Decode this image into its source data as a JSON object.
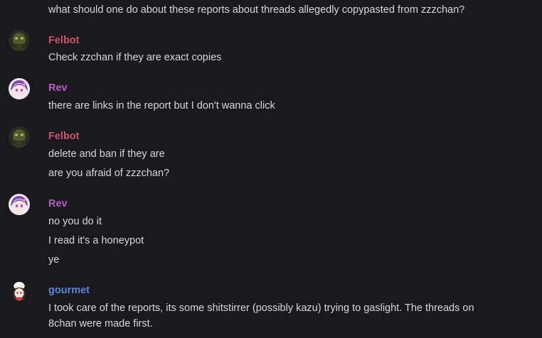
{
  "colors": {
    "background": "#1a1a1e",
    "text": "#d8d8da",
    "felbot": "#d0506e",
    "rev": "#b75bc6",
    "gourmet": "#5b86d6"
  },
  "messages": {
    "m0": {
      "lines": [
        "what should one do about these reports about threads allegedly copypasted from zzzchan?"
      ]
    },
    "m1": {
      "author": "Felbot",
      "avatar_icon": "green-monster-avatar-icon",
      "lines": [
        "Check zzchan if they are exact copies"
      ]
    },
    "m2": {
      "author": "Rev",
      "avatar_icon": "anime-girl-avatar-icon",
      "lines": [
        "there are links in the report but I don't wanna click"
      ]
    },
    "m3": {
      "author": "Felbot",
      "avatar_icon": "green-monster-avatar-icon",
      "lines": [
        "delete and ban if they are",
        "are you afraid of zzzchan?"
      ]
    },
    "m4": {
      "author": "Rev",
      "avatar_icon": "anime-girl-avatar-icon",
      "lines": [
        "no you do it",
        "I read it's a honeypot",
        "ye"
      ]
    },
    "m5": {
      "author": "gourmet",
      "avatar_icon": "chef-girl-avatar-icon",
      "lines": [
        "I took care of the reports, its some shitstirrer (possibly kazu) trying to gaslight. The threads on 8chan were made first."
      ]
    }
  }
}
